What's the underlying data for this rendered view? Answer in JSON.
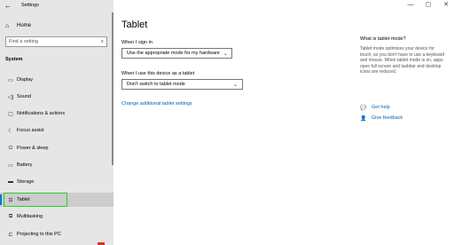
{
  "window": {
    "title": "Settings",
    "back_icon": "←",
    "minimize": "—",
    "maximize": "▢",
    "close": "✕"
  },
  "sidebar": {
    "home": {
      "label": "Home",
      "icon": "⌂"
    },
    "search": {
      "placeholder": "Find a setting",
      "icon": "⌕"
    },
    "section": "System",
    "items": [
      {
        "label": "Display",
        "icon": "▭"
      },
      {
        "label": "Sound",
        "icon": "◁)"
      },
      {
        "label": "Notifications & actions",
        "icon": "▢"
      },
      {
        "label": "Focus assist",
        "icon": "☾"
      },
      {
        "label": "Power & sleep",
        "icon": "⏻"
      },
      {
        "label": "Battery",
        "icon": "▭"
      },
      {
        "label": "Storage",
        "icon": "▬"
      },
      {
        "label": "Tablet",
        "icon": "⊡"
      },
      {
        "label": "Multitasking",
        "icon": "⧉"
      },
      {
        "label": "Projecting to this PC",
        "icon": "⊏"
      }
    ],
    "active_index": 7
  },
  "main": {
    "title": "Tablet",
    "signin_label": "When I sign in",
    "signin_value": "Use the appropriate mode for my hardware",
    "tablet_label": "When I use this device as a tablet",
    "tablet_value": "Don't switch to tablet mode",
    "link": "Change additional tablet settings"
  },
  "help": {
    "title": "What is tablet mode?",
    "text": "Tablet mode optimizes your device for touch, so you don't have to use a keyboard and mouse. When tablet mode is on, apps open full screen and taskbar and desktop icons are reduced.",
    "get_help": "Get help",
    "give_feedback": "Give feedback",
    "get_help_icon": "💬",
    "feedback_icon": "👤"
  },
  "colors": {
    "accent": "#0078d7",
    "link": "#0063b1",
    "highlight_box": "#2ecc2e",
    "sidebar_bg": "#e6e6e6"
  }
}
